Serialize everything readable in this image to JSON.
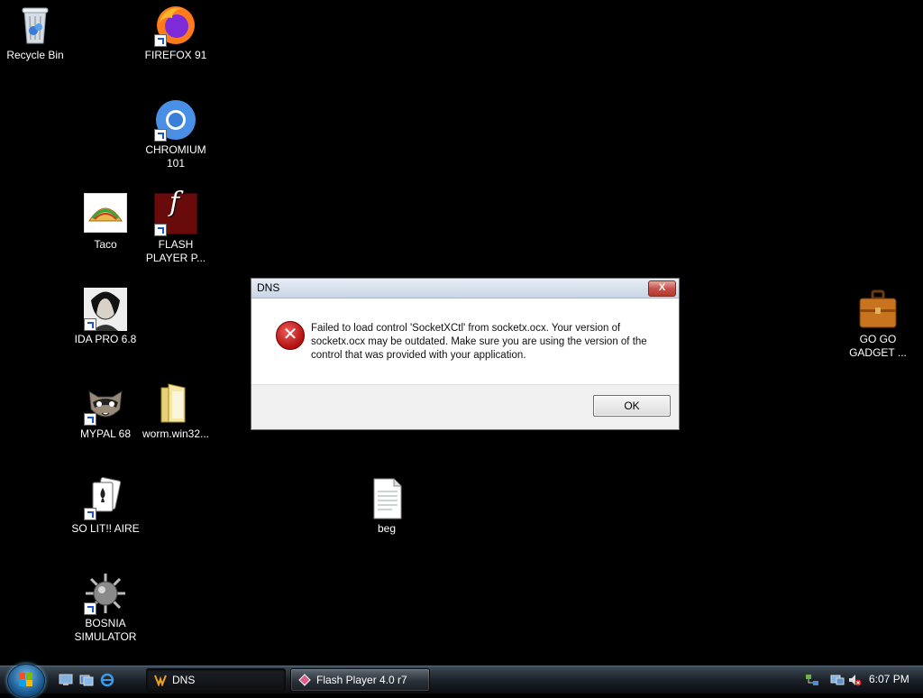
{
  "desktop": {
    "icons": {
      "recycle_bin": "Recycle Bin",
      "firefox": "FIREFOX 91",
      "chromium": "CHROMIUM\n101",
      "taco": "Taco",
      "flash": "FLASH\nPLAYER P...",
      "ida": "IDA PRO 6.8",
      "mypal": "MYPAL 68",
      "worm": "worm.win32...",
      "solitaire": "SO LIT!! AIRE",
      "bosnia": "BOSNIA\nSIMULATOR",
      "beg": "beg",
      "gogo": "GO GO\nGADGET ..."
    }
  },
  "dialog": {
    "title": "DNS",
    "close_glyph": "X",
    "error_glyph": "✕",
    "message": "Failed to load control 'SocketXCtl' from socketx.ocx.  Your version of socketx.ocx may be outdated.  Make sure you are using the version of the control that was provided with your application.",
    "ok_label": "OK"
  },
  "taskbar": {
    "buttons": [
      {
        "label": "DNS"
      },
      {
        "label": "Flash Player 4.0 r7"
      }
    ],
    "clock": "6:07 PM"
  },
  "colors": {
    "desktop": "#000000",
    "dialog_title_bg": "#d5dfea",
    "error_red": "#c01818",
    "taskbar": "#1b2128"
  }
}
